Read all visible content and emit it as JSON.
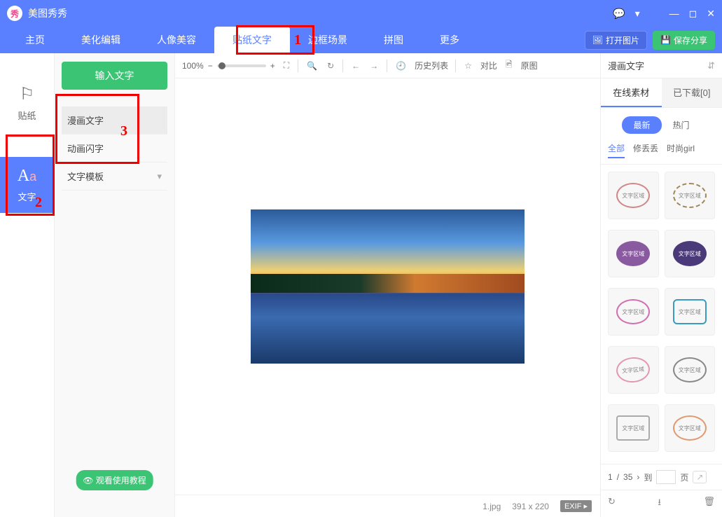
{
  "app": {
    "title": "美图秀秀"
  },
  "nav": {
    "items": [
      "主页",
      "美化编辑",
      "人像美容",
      "贴纸文字",
      "边框场景",
      "拼图",
      "更多"
    ],
    "active_index": 3,
    "open_image": "打开图片",
    "save_share": "保存分享"
  },
  "left_tabs": {
    "sticker": "贴纸",
    "text": "文字"
  },
  "left_panel": {
    "input_text": "输入文字",
    "types": [
      "漫画文字",
      "动画闪字",
      "文字模板"
    ],
    "selected_index": 0,
    "tutorial": "观看使用教程"
  },
  "toolbar": {
    "zoom": "100%",
    "history": "历史列表",
    "compare": "对比",
    "original": "原图"
  },
  "status": {
    "filename": "1.jpg",
    "dimensions": "391 x 220",
    "exif": "EXIF"
  },
  "right_panel": {
    "dropdown": "漫画文字",
    "tabs": [
      "在线素材",
      "已下载[0]"
    ],
    "active_tab": 0,
    "pills": [
      "最新",
      "热门"
    ],
    "active_pill": 0,
    "categories": [
      "全部",
      "修丢丢",
      "时尚girl"
    ],
    "active_cat": 0,
    "asset_label": "文字区域",
    "pager": {
      "current": "1",
      "total": "35",
      "goto_label": "到",
      "page_label": "页"
    }
  },
  "annotations": {
    "a1": "1",
    "a2": "2",
    "a3": "3"
  }
}
